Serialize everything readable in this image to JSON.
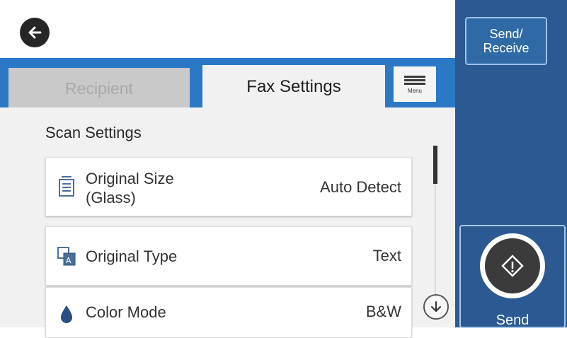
{
  "header": {
    "back_icon": "arrow-left-icon"
  },
  "tabs": [
    {
      "label": "Recipient",
      "active": false
    },
    {
      "label": "Fax Settings",
      "active": true
    }
  ],
  "menu": {
    "label": "Menu",
    "icon": "menu-lines-icon"
  },
  "section": {
    "title": "Scan Settings"
  },
  "settings": [
    {
      "label": "Original Size (Glass)",
      "value": "Auto Detect",
      "icon": "original-size-icon"
    },
    {
      "label": "Original Type",
      "value": "Text",
      "icon": "original-type-icon"
    },
    {
      "label": "Color Mode",
      "value": "B&W",
      "icon": "color-mode-icon"
    }
  ],
  "side": {
    "send_receive_line1": "Send/",
    "send_receive_line2": "Receive",
    "send_label": "Send",
    "send_icon": "diamond-start-icon"
  },
  "colors": {
    "tab_bar_blue": "#2b79c6",
    "side_panel_blue": "#2b5a92",
    "content_bg": "#f1f1f1"
  }
}
